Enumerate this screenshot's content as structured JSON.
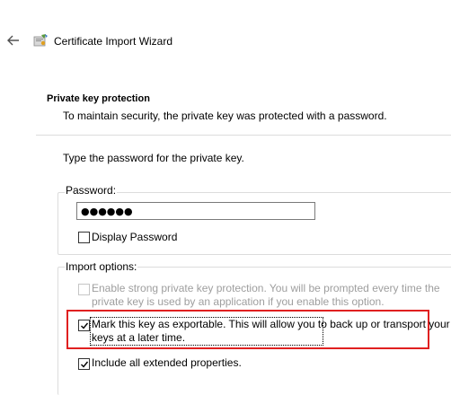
{
  "window": {
    "title": "Certificate Import Wizard",
    "back_icon": "arrow-left-icon",
    "app_icon": "certificate-wizard-icon"
  },
  "page": {
    "heading": "Private key protection",
    "subheading": "To maintain security, the private key was protected with a password.",
    "prompt": "Type the password for the private key."
  },
  "password": {
    "group_label": "Password:",
    "value": "●●●●●●",
    "display_password_label": "Display Password",
    "display_password_checked": false
  },
  "import_options": {
    "group_label": "Import options:",
    "options": [
      {
        "lines": [
          "Enable strong private key protection. You will be prompted every time the",
          "private key is used by an application if you enable this option."
        ],
        "checked": false,
        "enabled": false
      },
      {
        "lines": [
          "Mark this key as exportable. This will allow you to back up or transport your",
          "keys at a later time."
        ],
        "checked": true,
        "enabled": true,
        "highlighted": true
      },
      {
        "lines": [
          "Include all extended properties."
        ],
        "checked": true,
        "enabled": true
      }
    ]
  },
  "colors": {
    "highlight_border": "#e02020",
    "separator": "#dcdcdc",
    "disabled_text": "#9e9e9e"
  }
}
